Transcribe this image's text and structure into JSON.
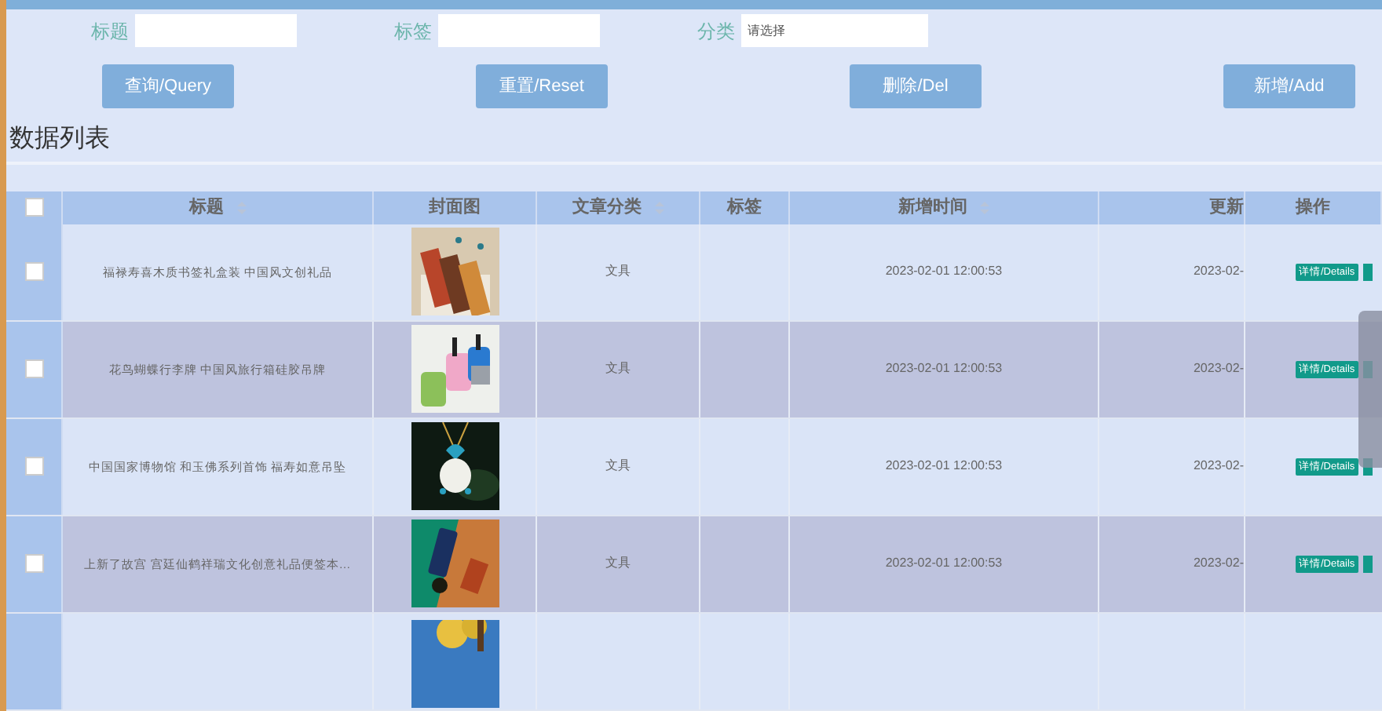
{
  "filters": [
    {
      "label": "标题",
      "kind": "text"
    },
    {
      "label": "标签",
      "kind": "text"
    },
    {
      "label": "分类",
      "kind": "select",
      "placeholder": "请选择"
    }
  ],
  "buttons": [
    "查询/Query",
    "重置/Reset",
    "删除/Del",
    "新增/Add"
  ],
  "section_title": "数据列表",
  "table": {
    "columns": [
      {
        "kind": "checkbox",
        "checked": false
      },
      {
        "label": "标题",
        "sortable": true
      },
      {
        "label": "封面图"
      },
      {
        "label": "文章分类",
        "sortable": true
      },
      {
        "label": "标签"
      },
      {
        "label": "新增时间",
        "sortable": true
      },
      {
        "label": "更新"
      },
      {
        "label": "操作"
      }
    ],
    "rows": [
      {
        "checked": false,
        "title": "福禄寿喜木质书签礼盒装 中国风文创礼品",
        "cover": {
          "kind": "picture"
        },
        "category": "文具",
        "created": "2023-02-01 12:00:53",
        "updated": "2023-02-",
        "action": "详情/Details"
      },
      {
        "checked": false,
        "title": "花鸟蝴蝶行李牌 中国风旅行箱硅胶吊牌",
        "cover": {
          "kind": "picture"
        },
        "category": "文具",
        "created": "2023-02-01 12:00:53",
        "updated": "2023-02-",
        "action": "详情/Details"
      },
      {
        "checked": false,
        "title": "中国国家博物馆 和玉佛系列首饰 福寿如意吊坠",
        "cover": {
          "kind": "picture"
        },
        "category": "文具",
        "created": "2023-02-01 12:00:53",
        "updated": "2023-02-",
        "action": "详情/Details"
      },
      {
        "checked": false,
        "title": "上新了故宫 宫廷仙鹤祥瑞文化创意礼品便签本…",
        "cover": {
          "kind": "picture"
        },
        "category": "文具",
        "created": "2023-02-01 12:00:53",
        "updated": "2023-02-",
        "action": "详情/Details"
      },
      {
        "cover": {
          "kind": "picture"
        }
      }
    ]
  }
}
